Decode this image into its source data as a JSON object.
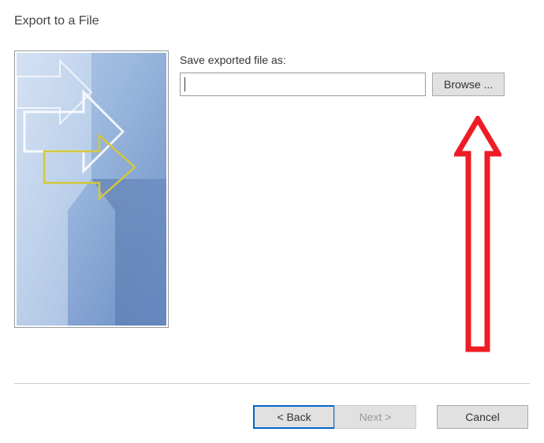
{
  "dialog": {
    "title": "Export to a File"
  },
  "form": {
    "label": "Save exported file as:",
    "file_value": "",
    "browse_label": "Browse ..."
  },
  "buttons": {
    "back": "< Back",
    "next": "Next >",
    "cancel": "Cancel"
  }
}
